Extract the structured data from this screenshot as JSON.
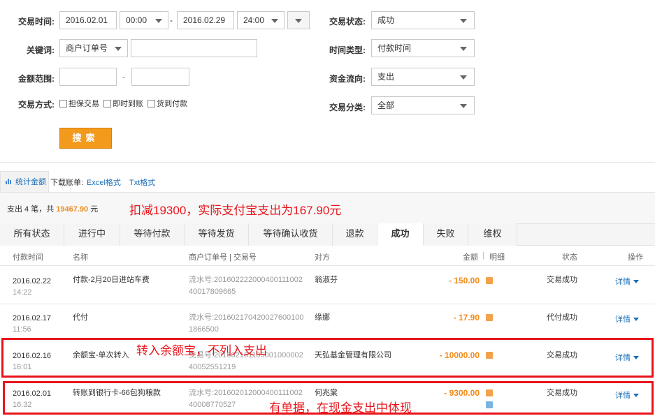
{
  "filters": {
    "trade_time_label": "交易时间:",
    "start_date": "2016.02.01",
    "start_time": "00:00",
    "dash": "-",
    "end_date": "2016.02.29",
    "end_time": "24:00",
    "status_label": "交易状态:",
    "status_value": "成功",
    "keyword_label": "关键词:",
    "keyword_type": "商户订单号",
    "keyword_value": "",
    "time_type_label": "时间类型:",
    "time_type_value": "付款时间",
    "amount_label": "金额范围:",
    "amount_min": "",
    "amount_dash": "-",
    "amount_max": "",
    "flow_label": "资金流向:",
    "flow_value": "支出",
    "method_label": "交易方式:",
    "method_opt1": "担保交易",
    "method_opt2": "即时到账",
    "method_opt3": "货到付款",
    "category_label": "交易分类:",
    "category_value": "全部",
    "search_button": "搜索"
  },
  "toolbar": {
    "stats_label": "统计金额",
    "download_label": "下载账单:",
    "excel_link": "Excel格式",
    "txt_link": "Txt格式"
  },
  "summary": {
    "prefix": "支出 4 笔，共",
    "total": "19467.90",
    "unit": "元",
    "annotation": "扣减19300，实际支付宝支出为167.90元"
  },
  "tabs": [
    "所有状态",
    "进行中",
    "等待付款",
    "等待发货",
    "等待确认收货",
    "退款",
    "成功",
    "失败",
    "维权"
  ],
  "active_tab_index": 6,
  "columns": {
    "time": "付款时间",
    "name": "名称",
    "order": "商户订单号 | 交易号",
    "party": "对方",
    "amount": "金额",
    "detail_sep": "明细",
    "status": "状态",
    "op": "操作"
  },
  "rows": [
    {
      "date": "2016.02.22",
      "time": "14:22",
      "name": "付款-2月20日进站车费",
      "serial1": "流水号:20160222200040011100​2",
      "serial2": "40017809665",
      "party": "翁淑芬",
      "amount": "- 150.00",
      "status": "交易成功",
      "op": "详情"
    },
    {
      "date": "2016.02.17",
      "time": "11:56",
      "name": "代付",
      "serial1": "流水号:20160217042002760010​0",
      "serial2": "1866500",
      "party": "缘娜",
      "amount": "- 17.90",
      "status": "代付成功",
      "op": "详情"
    },
    {
      "date": "2016.02.16",
      "time": "16:01",
      "name": "余额宝-单次转入",
      "serial1": "交易号:20160216110500100000​2",
      "serial2": "40052551219",
      "party": "天弘基金管理有限公司",
      "amount": "- 10000.00",
      "status": "交易成功",
      "op": "详情"
    },
    {
      "date": "2016.02.01",
      "time": "16:32",
      "name": "转账到银行卡-66包狗粮款",
      "serial1": "流水号:20160201200040011100​2",
      "serial2": "40008770527",
      "party": "何兆棠",
      "amount": "- 9300.00",
      "status": "交易成功",
      "op": "详情"
    }
  ],
  "annotations": {
    "yuebao_note": "转入余额宝，不列入支出",
    "bank_note": "有单据，在现金支出中体现"
  }
}
